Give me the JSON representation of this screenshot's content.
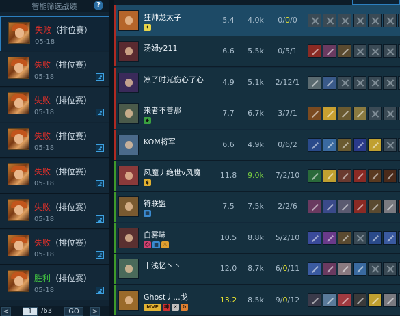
{
  "filter": {
    "title": "智能筛选战绩",
    "help": "?"
  },
  "matches": [
    {
      "result": "失败",
      "type": "（排位赛）",
      "date": "05-18",
      "win": false,
      "replay": false,
      "selected": true
    },
    {
      "result": "失败",
      "type": "（排位赛）",
      "date": "05-18",
      "win": false,
      "replay": true,
      "selected": false
    },
    {
      "result": "失败",
      "type": "（排位赛）",
      "date": "05-18",
      "win": false,
      "replay": true,
      "selected": false
    },
    {
      "result": "失败",
      "type": "（排位赛）",
      "date": "05-18",
      "win": false,
      "replay": true,
      "selected": false
    },
    {
      "result": "失败",
      "type": "（排位赛）",
      "date": "05-18",
      "win": false,
      "replay": true,
      "selected": false
    },
    {
      "result": "失败",
      "type": "（排位赛）",
      "date": "05-18",
      "win": false,
      "replay": true,
      "selected": false
    },
    {
      "result": "失败",
      "type": "（排位赛）",
      "date": "05-18",
      "win": false,
      "replay": true,
      "selected": false
    },
    {
      "result": "胜利",
      "type": "（排位赛）",
      "date": "05-18",
      "win": true,
      "replay": true,
      "selected": false
    }
  ],
  "pager": {
    "prev": "<",
    "page": "1",
    "total": "/63",
    "go": "GO",
    "next": ">"
  },
  "players": [
    {
      "name": "狂帅龙太子",
      "team": "red",
      "me": true,
      "score": "5.4",
      "gold": "4.0k",
      "kda": [
        "0",
        "0",
        "0"
      ],
      "kda_hl": [
        false,
        true,
        false
      ],
      "score_hl": false,
      "gold_hl": false,
      "avatar_color": "#b5652a",
      "badges": [
        {
          "color": "#e8d54a",
          "t": "✦"
        }
      ],
      "items": [
        "empty",
        "empty",
        "empty",
        "empty",
        "empty",
        "empty",
        "empty"
      ]
    },
    {
      "name": "汤姆y211",
      "team": "red",
      "me": false,
      "score": "6.6",
      "gold": "5.5k",
      "kda": [
        "0",
        "5",
        "1"
      ],
      "kda_hl": [
        false,
        false,
        false
      ],
      "score_hl": false,
      "gold_hl": false,
      "avatar_color": "#5a2a30",
      "badges": [],
      "items": [
        "#8a2a24",
        "#6a3a60",
        "#5a4a30",
        "empty",
        "empty",
        "empty",
        "empty"
      ]
    },
    {
      "name": "凉了时光伤心了心",
      "team": "red",
      "me": false,
      "score": "4.9",
      "gold": "5.1k",
      "kda": [
        "2",
        "12",
        "1"
      ],
      "kda_hl": [
        false,
        false,
        false
      ],
      "score_hl": false,
      "gold_hl": false,
      "avatar_color": "#3a2a5a",
      "badges": [],
      "items": [
        "#5a6a70",
        "#3a5a8a",
        "empty",
        "empty",
        "empty",
        "empty",
        "empty"
      ]
    },
    {
      "name": "来者不善那",
      "team": "red",
      "me": false,
      "score": "7.7",
      "gold": "6.7k",
      "kda": [
        "3",
        "7",
        "1"
      ],
      "kda_hl": [
        false,
        false,
        false
      ],
      "score_hl": false,
      "gold_hl": false,
      "avatar_color": "#4a5a4a",
      "badges": [
        {
          "color": "#3aa040",
          "t": "◆"
        }
      ],
      "items": [
        "#7a4a20",
        "#c8a030",
        "#6a5a30",
        "#8a7a40",
        "empty",
        "empty",
        "empty"
      ]
    },
    {
      "name": "KOM将军",
      "team": "red",
      "me": false,
      "score": "6.6",
      "gold": "4.9k",
      "kda": [
        "0",
        "6",
        "2"
      ],
      "kda_hl": [
        false,
        false,
        false
      ],
      "score_hl": false,
      "gold_hl": false,
      "avatar_color": "#4a6a8a",
      "badges": [],
      "items": [
        "#2a4a8a",
        "#3a6aa0",
        "#6a5a30",
        "#2a3a8a",
        "#c0a030",
        "empty",
        "empty"
      ]
    },
    {
      "name": "风魔丿绝世v风魔",
      "team": "green",
      "me": false,
      "score": "11.8",
      "gold": "9.0k",
      "kda": [
        "7",
        "2",
        "10"
      ],
      "kda_hl": [
        false,
        false,
        false
      ],
      "score_hl": false,
      "gold_hl": true,
      "avatar_color": "#8a3a3a",
      "badges": [
        {
          "color": "#e0b030",
          "t": "$"
        }
      ],
      "items": [
        "#2a6a3a",
        "#c0a030",
        "#6a3a30",
        "#8a2a24",
        "#5a3a20",
        "#4a2a1a",
        "empty"
      ]
    },
    {
      "name": "符联盟",
      "team": "green",
      "me": false,
      "score": "7.5",
      "gold": "7.5k",
      "kda": [
        "2",
        "2",
        "6"
      ],
      "kda_hl": [
        false,
        false,
        false
      ],
      "score_hl": false,
      "gold_hl": false,
      "avatar_color": "#7a5a30",
      "badges": [
        {
          "color": "#3a8ad0",
          "t": "▦"
        }
      ],
      "items": [
        "#6a3a60",
        "#3a4a8a",
        "#5a5a70",
        "#8a2a24",
        "#5a4a30",
        "#7a7a80",
        "#6a2a20"
      ]
    },
    {
      "name": "白雾啸",
      "team": "green",
      "me": false,
      "score": "10.5",
      "gold": "8.8k",
      "kda": [
        "5",
        "2",
        "10"
      ],
      "kda_hl": [
        false,
        false,
        false
      ],
      "score_hl": false,
      "gold_hl": false,
      "avatar_color": "#5a3030",
      "badges": [
        {
          "color": "#d04070",
          "t": "☺"
        },
        {
          "color": "#3a8ad0",
          "t": "▦"
        },
        {
          "color": "#e0a030",
          "t": "♨"
        }
      ],
      "items": [
        "#3a4a9a",
        "#6a3a8a",
        "#5a4a30",
        "empty",
        "#2a4a8a",
        "#3a5aa0",
        "#2a3a6a"
      ]
    },
    {
      "name": "丨浅忆丶丶",
      "team": "green",
      "me": false,
      "score": "12.0",
      "gold": "8.7k",
      "kda": [
        "6",
        "0",
        "11"
      ],
      "kda_hl": [
        false,
        true,
        false
      ],
      "score_hl": false,
      "gold_hl": false,
      "avatar_color": "#4a6a5a",
      "badges": [],
      "items": [
        "#3a5aa0",
        "#6a3a60",
        "#8a7a80",
        "#3a6aa0",
        "empty",
        "empty",
        "empty"
      ]
    },
    {
      "name": "Ghost丿...戈",
      "team": "green",
      "me": false,
      "score": "13.2",
      "gold": "8.5k",
      "kda": [
        "9",
        "0",
        "12"
      ],
      "kda_hl": [
        false,
        true,
        false
      ],
      "score_hl": true,
      "gold_hl": false,
      "avatar_color": "#9a6a2a",
      "badges": [
        {
          "color": "#e3b534",
          "t": "MVP",
          "mvp": true
        },
        {
          "color": "#d03030",
          "t": "神"
        },
        {
          "color": "#c0c0c0",
          "t": "✕"
        },
        {
          "color": "#e08030",
          "t": "↻"
        }
      ],
      "items": [
        "#3a3a4a",
        "#5a7a9a",
        "#a03a40",
        "#3a3a3a",
        "#c0a030",
        "#7a7a80",
        "empty"
      ]
    }
  ]
}
